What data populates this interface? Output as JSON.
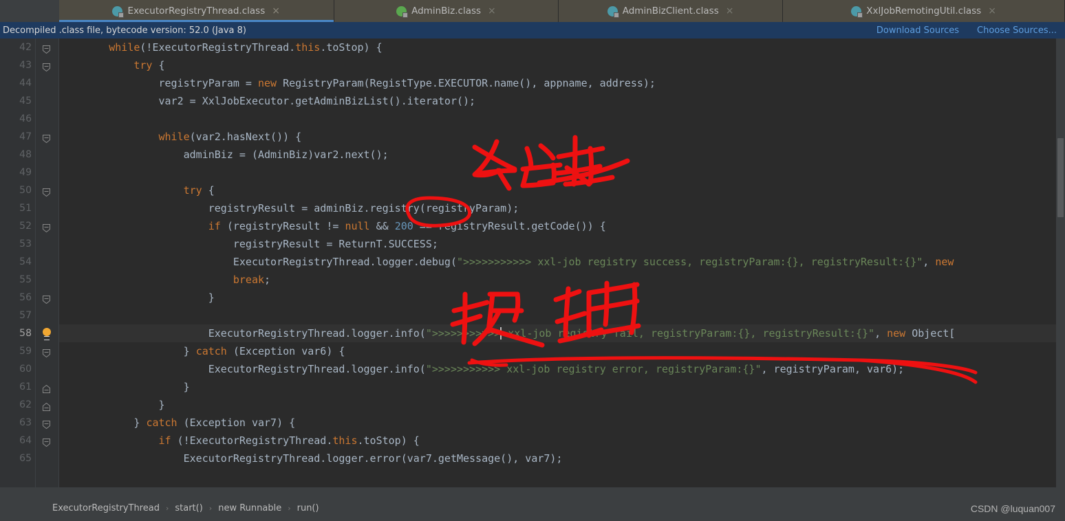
{
  "tabs": [
    {
      "label": "ExecutorRegistryThread.class",
      "icon": "java-class-icon",
      "icon_kind": "c",
      "active": true,
      "close": "×"
    },
    {
      "label": "AdminBiz.class",
      "icon": "java-interface-icon",
      "icon_kind": "i",
      "active": false,
      "close": "×"
    },
    {
      "label": "AdminBizClient.class",
      "icon": "java-class-icon",
      "icon_kind": "c",
      "active": false,
      "close": "×"
    },
    {
      "label": "XxlJobRemotingUtil.class",
      "icon": "java-class-icon",
      "icon_kind": "c",
      "active": false,
      "close": "×"
    }
  ],
  "notice": {
    "text": "Decompiled .class file, bytecode version: 52.0 (Java 8)",
    "download_sources": "Download Sources",
    "choose_sources": "Choose Sources..."
  },
  "editor": {
    "current_line": 58,
    "lines": [
      {
        "n": 42,
        "fold": "minus",
        "html": "        <span class='kw'>while</span>(!ExecutorRegistryThread.<span class='kw'>this</span>.toStop) {"
      },
      {
        "n": 43,
        "fold": "minus",
        "html": "            <span class='kw'>try</span> {"
      },
      {
        "n": 44,
        "fold": "",
        "html": "                registryParam = <span class='kw'>new</span> RegistryParam(RegistType.EXECUTOR.name(), appname, address);"
      },
      {
        "n": 45,
        "fold": "",
        "html": "                var2 = XxlJobExecutor.getAdminBizList().iterator();"
      },
      {
        "n": 46,
        "fold": "",
        "html": ""
      },
      {
        "n": 47,
        "fold": "minus",
        "html": "                <span class='kw'>while</span>(var2.hasNext()) {"
      },
      {
        "n": 48,
        "fold": "",
        "html": "                    adminBiz = (AdminBiz)var2.next();"
      },
      {
        "n": 49,
        "fold": "",
        "html": ""
      },
      {
        "n": 50,
        "fold": "minus",
        "html": "                    <span class='kw'>try</span> {"
      },
      {
        "n": 51,
        "fold": "",
        "html": "                        registryResult = adminBiz.registry(registryParam);"
      },
      {
        "n": 52,
        "fold": "minus",
        "html": "                        <span class='kw'>if</span> (registryResult != <span class='kw'>null</span> &amp;&amp; <span class='num'>200</span> == registryResult.getCode()) {"
      },
      {
        "n": 53,
        "fold": "",
        "html": "                            registryResult = ReturnT.SUCCESS;"
      },
      {
        "n": 54,
        "fold": "",
        "html": "                            ExecutorRegistryThread.logger.debug(<span class='str'>\"&gt;&gt;&gt;&gt;&gt;&gt;&gt;&gt;&gt;&gt;&gt; xxl-job registry success, registryParam:{}, registryResult:{}\"</span>, <span class='kw'>new</span>"
      },
      {
        "n": 55,
        "fold": "",
        "html": "                            <span class='kw'>break</span>;"
      },
      {
        "n": 56,
        "fold": "minus",
        "html": "                        }"
      },
      {
        "n": 57,
        "fold": "",
        "html": ""
      },
      {
        "n": 58,
        "fold": "bulb",
        "html": "                        ExecutorRegistryThread.logger.info(<span class='str'>\"&gt;&gt;&gt;&gt;&gt;&gt;&gt;&gt;&gt;&gt;&gt;</span><span class='caret'></span><span class='str'> xxl-job registry fail, registryParam:{}, registryResult:{}\"</span>, <span class='kw'>new</span> Object["
      },
      {
        "n": 59,
        "fold": "minus",
        "html": "                    } <span class='kw'>catch</span> (Exception var6) {"
      },
      {
        "n": 60,
        "fold": "",
        "html": "                        ExecutorRegistryThread.logger.info(<span class='str'>\"&gt;&gt;&gt;&gt;&gt;&gt;&gt;&gt;&gt;&gt;&gt; xxl-job registry error, registryParam:{}\"</span>, registryParam, var6);"
      },
      {
        "n": 61,
        "fold": "plus",
        "html": "                    }"
      },
      {
        "n": 62,
        "fold": "plus",
        "html": "                }"
      },
      {
        "n": 63,
        "fold": "minus",
        "html": "            } <span class='kw'>catch</span> (Exception var7) {"
      },
      {
        "n": 64,
        "fold": "minus",
        "html": "                <span class='kw'>if</span> (!ExecutorRegistryThread.<span class='kw'>this</span>.toStop) {"
      },
      {
        "n": 65,
        "fold": "",
        "html": "                    ExecutorRegistryThread.logger.error(var7.getMessage(), var7);"
      }
    ]
  },
  "breadcrumb": {
    "items": [
      "ExecutorRegistryThread",
      "start()",
      "new Runnable",
      "run()"
    ],
    "separator": "›"
  },
  "watermark": "CSDN @luquan007",
  "annotations": {
    "note_1_text": "关键",
    "note_1_meaning": "key / critical",
    "note_2_text": "报错",
    "note_2_meaning": "error reported",
    "ellipse_target": "registry",
    "underline_target": "line-58-log-statement",
    "ink_color": "#ee1111"
  },
  "colors": {
    "editor_bg": "#2b2b2b",
    "gutter_bg": "#313335",
    "chrome_bg": "#3c3f41",
    "tab_active_bg": "#4e4b42",
    "tab_accent": "#4a88c7",
    "notice_bg": "#1e3a5f",
    "link": "#5f9fe0",
    "keyword": "#cc7832",
    "string": "#6a8759",
    "number": "#6897bb",
    "default_text": "#a9b7c6",
    "line_number": "#606366",
    "current_line_bg": "#323232",
    "bulb": "#f0a732",
    "ink": "#ee1111"
  }
}
